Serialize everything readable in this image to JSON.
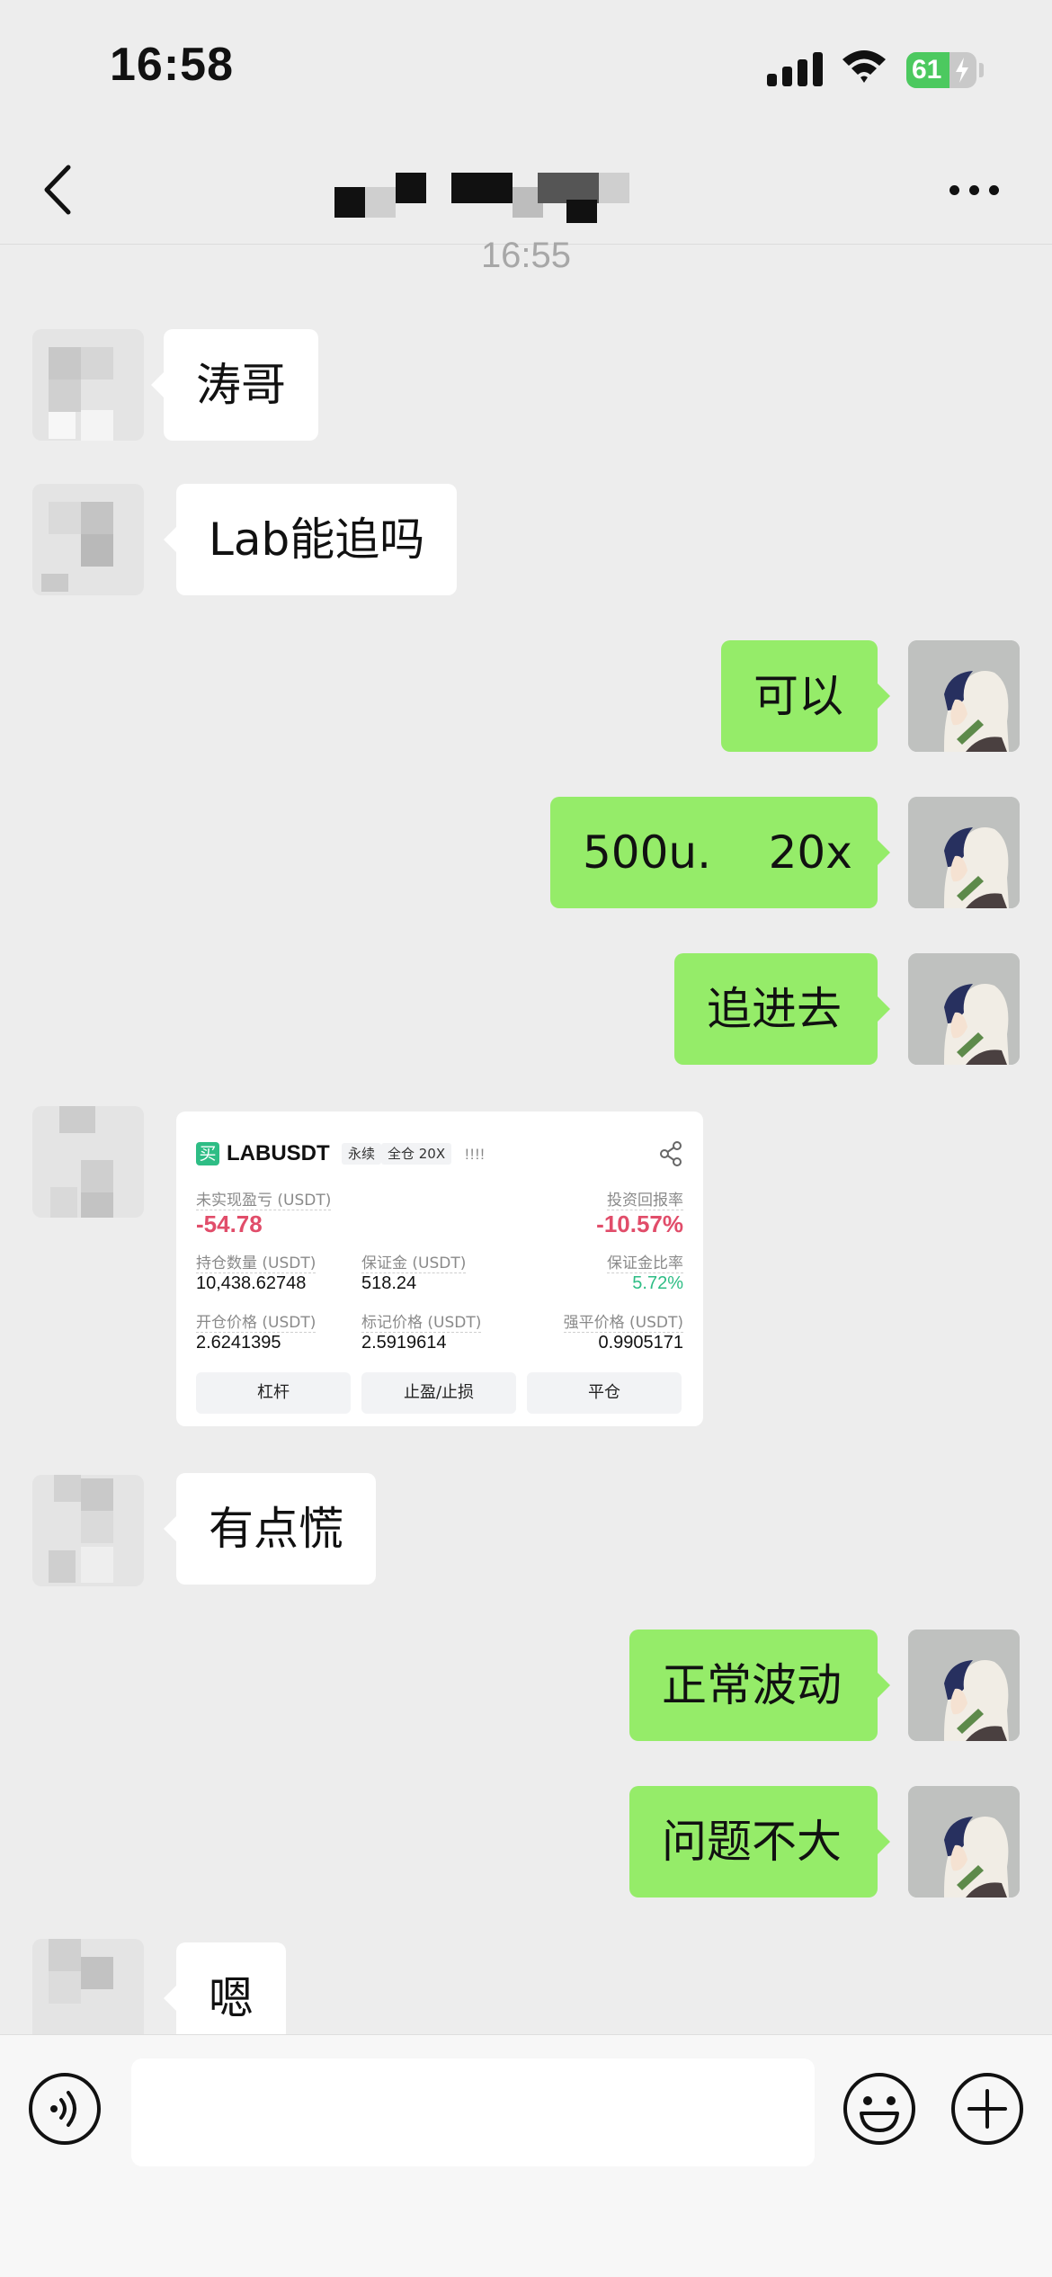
{
  "status_bar": {
    "time": "16:58",
    "battery": "61"
  },
  "nav": {
    "title": ""
  },
  "timestamp": "16:55",
  "messages": [
    {
      "side": "in",
      "text": "涛哥"
    },
    {
      "side": "in",
      "text": "Lab能追吗"
    },
    {
      "side": "out",
      "text": "可以"
    },
    {
      "side": "out",
      "text": "500u.    20x"
    },
    {
      "side": "out",
      "text": "追进去"
    },
    {
      "side": "in",
      "type": "image",
      "text": ""
    },
    {
      "side": "in",
      "text": "有点慌"
    },
    {
      "side": "out",
      "text": "正常波动"
    },
    {
      "side": "out",
      "text": "问题不大"
    },
    {
      "side": "in",
      "text": "嗯"
    }
  ],
  "trade_card": {
    "buy_badge": "买",
    "symbol": "LABUSDT",
    "tag_perpetual": "永续",
    "tag_margin": "全仓 20X",
    "bars": "!!!!",
    "unrealized_pnl_label": "未实现盈亏 (USDT)",
    "unrealized_pnl_value": "-54.78",
    "roi_label": "投资回报率",
    "roi_value": "-10.57%",
    "position_size_label": "持仓数量 (USDT)",
    "position_size_value": "10,438.62748",
    "margin_label": "保证金 (USDT)",
    "margin_value": "518.24",
    "margin_ratio_label": "保证金比率",
    "margin_ratio_value": "5.72%",
    "entry_price_label": "开仓价格 (USDT)",
    "entry_price_value": "2.6241395",
    "mark_price_label": "标记价格 (USDT)",
    "mark_price_value": "2.5919614",
    "liq_price_label": "强平价格 (USDT)",
    "liq_price_value": "0.9905171",
    "btn_leverage": "杠杆",
    "btn_tpsl": "止盈/止损",
    "btn_close": "平仓"
  },
  "input": {
    "value": "",
    "placeholder": ""
  },
  "colors": {
    "background": "#ededed",
    "outgoing_bubble": "#95ec69",
    "incoming_bubble": "#ffffff",
    "loss_red": "#e14d6a",
    "gain_green": "#2ebd85"
  },
  "icons": [
    "back-arrow-icon",
    "more-icon",
    "voice-icon",
    "emoji-icon",
    "plus-icon",
    "share-icon",
    "wifi-icon",
    "signal-icon",
    "battery-icon"
  ]
}
